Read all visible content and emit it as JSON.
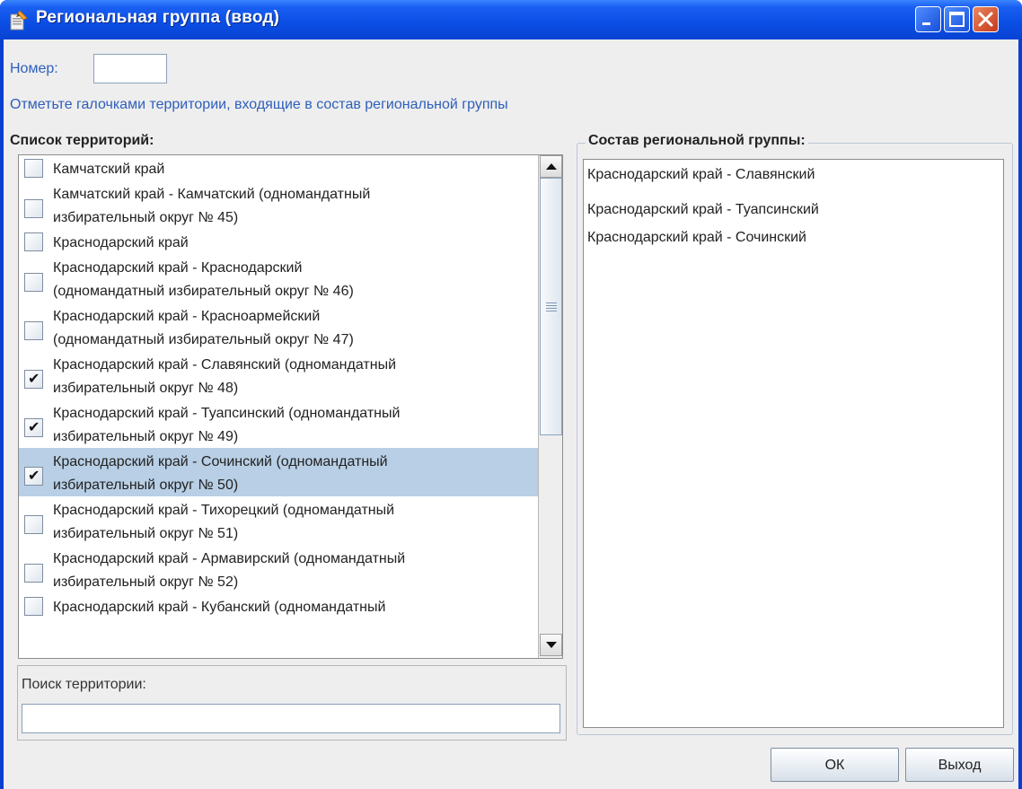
{
  "window": {
    "title": "Региональная группа (ввод)"
  },
  "number": {
    "label": "Номер:",
    "value": ""
  },
  "instruction": "Отметьте галочками территории, входящие в состав региональной группы",
  "territories": {
    "heading": "Список территорий:",
    "items": [
      {
        "lines": [
          "Камчатский край"
        ],
        "checked": false,
        "selected": false
      },
      {
        "lines": [
          "Камчатский край - Камчатский (одномандатный",
          "избирательный округ № 45)"
        ],
        "checked": false,
        "selected": false
      },
      {
        "lines": [
          "Краснодарский край"
        ],
        "checked": false,
        "selected": false
      },
      {
        "lines": [
          "Краснодарский край - Краснодарский",
          "(одномандатный избирательный округ № 46)"
        ],
        "checked": false,
        "selected": false
      },
      {
        "lines": [
          "Краснодарский край - Красноармейский",
          "(одномандатный избирательный округ № 47)"
        ],
        "checked": false,
        "selected": false
      },
      {
        "lines": [
          "Краснодарский край - Славянский (одномандатный",
          "избирательный округ № 48)"
        ],
        "checked": true,
        "selected": false
      },
      {
        "lines": [
          "Краснодарский край - Туапсинский (одномандатный",
          "избирательный округ № 49)"
        ],
        "checked": true,
        "selected": false
      },
      {
        "lines": [
          "Краснодарский край - Сочинский (одномандатный",
          "избирательный округ № 50)"
        ],
        "checked": true,
        "selected": true
      },
      {
        "lines": [
          "Краснодарский край - Тихорецкий (одномандатный",
          "избирательный округ № 51)"
        ],
        "checked": false,
        "selected": false
      },
      {
        "lines": [
          "Краснодарский край - Армавирский (одномандатный",
          "избирательный округ № 52)"
        ],
        "checked": false,
        "selected": false
      },
      {
        "lines": [
          "Краснодарский край - Кубанский (одномандатный"
        ],
        "checked": false,
        "selected": false
      }
    ]
  },
  "search": {
    "label": "Поиск территории:",
    "value": ""
  },
  "group": {
    "heading": "Состав региональной группы:",
    "items": [
      "Краснодарский край - Славянский",
      "Краснодарский край - Туапсинский",
      "Краснодарский край - Сочинский"
    ]
  },
  "buttons": {
    "ok": "ОК",
    "exit": "Выход"
  }
}
